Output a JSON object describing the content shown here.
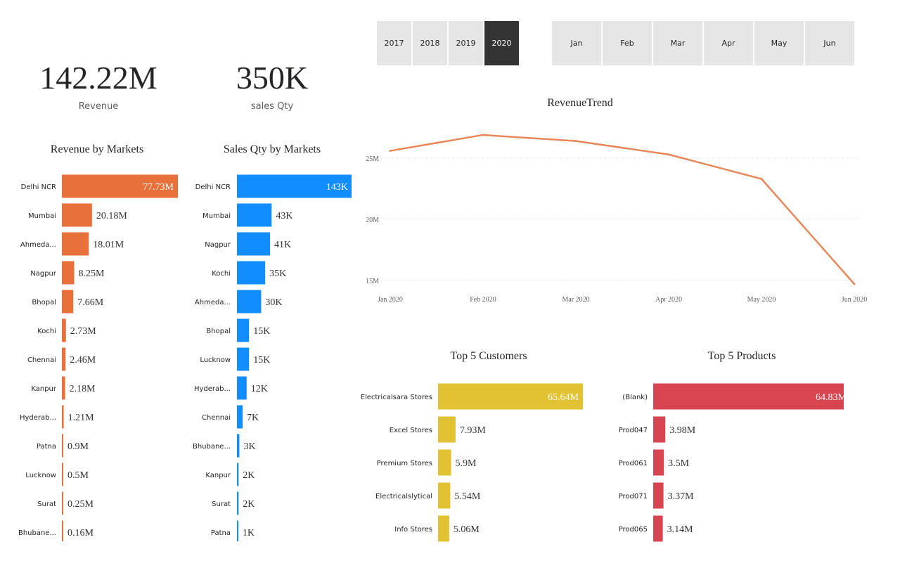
{
  "kpis": {
    "revenue": {
      "value": "142.22M",
      "label": "Revenue"
    },
    "qty": {
      "value": "350K",
      "label": "sales Qty"
    }
  },
  "year_slicer": {
    "options": [
      "2017",
      "2018",
      "2019",
      "2020"
    ],
    "selected": "2020"
  },
  "month_slicer": {
    "options": [
      "Jan",
      "Feb",
      "Mar",
      "Apr",
      "May",
      "Jun"
    ],
    "selected": ""
  },
  "colors": {
    "revenue": "#E8703A",
    "qty": "#118DFF",
    "customers": "#E1C233",
    "products": "#D64550",
    "selected": "#333333",
    "slicer_bg": "#E6E6E6"
  },
  "chart_data": [
    {
      "id": "rev_markets",
      "type": "bar",
      "orientation": "horizontal",
      "title": "Revenue by Markets",
      "categories": [
        "Delhi NCR",
        "Mumbai",
        "Ahmeda...",
        "Nagpur",
        "Bhopal",
        "Kochi",
        "Chennai",
        "Kanpur",
        "Hyderab...",
        "Patna",
        "Lucknow",
        "Surat",
        "Bhubane..."
      ],
      "values": [
        77.73,
        20.18,
        18.01,
        8.25,
        7.66,
        2.73,
        2.46,
        2.18,
        1.21,
        0.9,
        0.5,
        0.25,
        0.16
      ],
      "labels": [
        "77.73M",
        "20.18M",
        "18.01M",
        "8.25M",
        "7.66M",
        "2.73M",
        "2.46M",
        "2.18M",
        "1.21M",
        "0.9M",
        "0.5M",
        "0.25M",
        "0.16M"
      ],
      "color": "#E8703A"
    },
    {
      "id": "qty_markets",
      "type": "bar",
      "orientation": "horizontal",
      "title": "Sales Qty by Markets",
      "categories": [
        "Delhi NCR",
        "Mumbai",
        "Nagpur",
        "Kochi",
        "Ahmeda...",
        "Bhopal",
        "Lucknow",
        "Hyderab...",
        "Chennai",
        "Bhubane...",
        "Kanpur",
        "Surat",
        "Patna"
      ],
      "values": [
        143,
        43,
        41,
        35,
        30,
        15,
        15,
        12,
        7,
        3,
        2,
        2,
        1
      ],
      "labels": [
        "143K",
        "43K",
        "41K",
        "35K",
        "30K",
        "15K",
        "15K",
        "12K",
        "7K",
        "3K",
        "2K",
        "2K",
        "1K"
      ],
      "color": "#118DFF"
    },
    {
      "id": "trend",
      "type": "line",
      "title": "RevenueTrend",
      "x": [
        "Jan 2020",
        "Feb 2020",
        "Mar 2020",
        "Apr 2020",
        "May 2020",
        "Jun 2020"
      ],
      "y": [
        25.6,
        26.9,
        26.4,
        25.3,
        23.3,
        14.7
      ],
      "yticks": [
        "15M",
        "20M",
        "25M"
      ],
      "ytick_values": [
        15,
        20,
        25
      ],
      "ylim": [
        14.7,
        27.3
      ],
      "grid": true,
      "color": "#E8875A"
    },
    {
      "id": "customers",
      "type": "bar",
      "orientation": "horizontal",
      "title": "Top 5 Customers",
      "categories": [
        "Electricalsara Stores",
        "Excel Stores",
        "Premium Stores",
        "Electricalslytical",
        "Info Stores"
      ],
      "values": [
        65.64,
        7.93,
        5.9,
        5.54,
        5.06
      ],
      "labels": [
        "65.64M",
        "7.93M",
        "5.9M",
        "5.54M",
        "5.06M"
      ],
      "color": "#E1C233"
    },
    {
      "id": "products",
      "type": "bar",
      "orientation": "horizontal",
      "title": "Top 5 Products",
      "categories": [
        "(Blank)",
        "Prod047",
        "Prod061",
        "Prod071",
        "Prod065"
      ],
      "values": [
        64.83,
        3.98,
        3.5,
        3.37,
        3.14
      ],
      "labels": [
        "64.83M",
        "3.98M",
        "3.5M",
        "3.37M",
        "3.14M"
      ],
      "color": "#D64550"
    }
  ]
}
